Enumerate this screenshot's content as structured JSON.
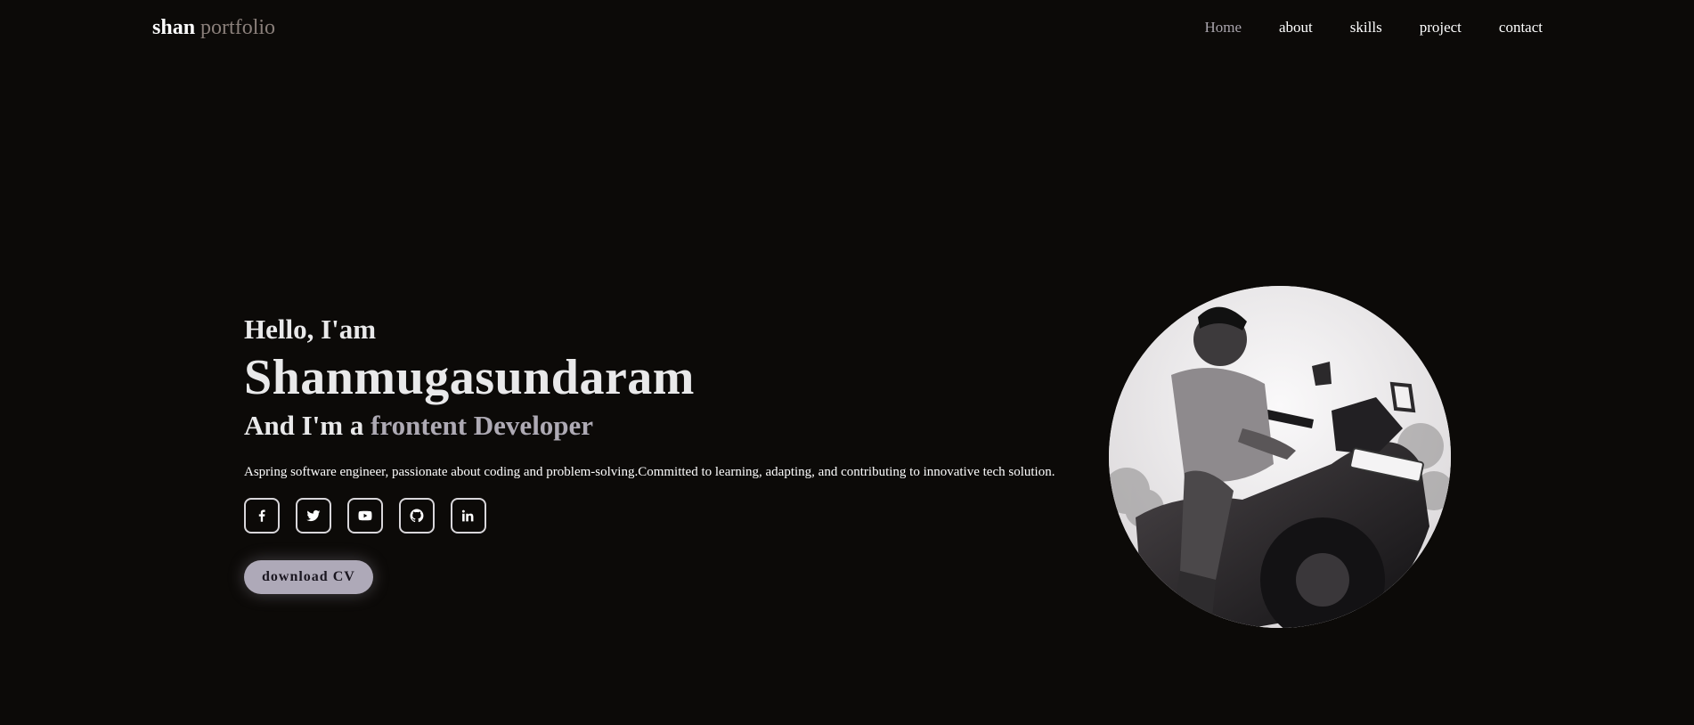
{
  "header": {
    "logo_main": "shan",
    "logo_accent": "portfolio",
    "nav": [
      "Home",
      "about",
      "skills",
      "project",
      "contact"
    ]
  },
  "hero": {
    "greeting": "Hello, I'am",
    "name": "Shanmugasundaram",
    "role_prefix": "And I'm a",
    "role_accent": "frontent Developer",
    "description": "Aspring software engineer, passionate about coding and problem-solving.Committed to learning, adapting, and contributing to innovative tech solution.",
    "socials": [
      "facebook-icon",
      "twitter-icon",
      "youtube-icon",
      "github-icon",
      "linkedin-icon"
    ],
    "cv_label": "download CV"
  },
  "colors": {
    "background": "#0c0a08",
    "accent": "#aea9b8",
    "logo_accent": "#8a7f7a"
  }
}
